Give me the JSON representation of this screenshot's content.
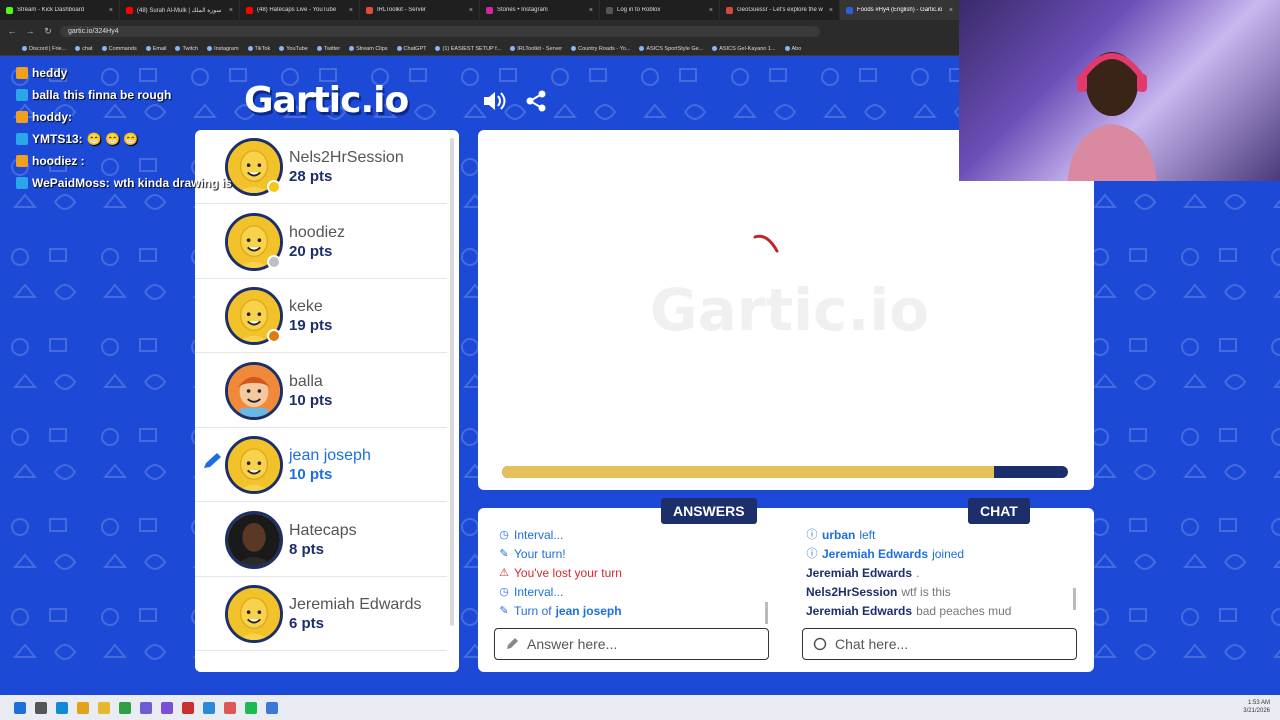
{
  "browser": {
    "tabs": [
      {
        "title": "Stream - Kick Dashboard",
        "color": "#53fc18"
      },
      {
        "title": "(48) Surah Al-Mulk | سورة الملك",
        "color": "#ff0000"
      },
      {
        "title": "(48) Hatecaps Live - YouTube",
        "color": "#ff0000"
      },
      {
        "title": "IRLToolkit - Server",
        "color": "#e24a3b"
      },
      {
        "title": "Stories • Instagram",
        "color": "#d6249f"
      },
      {
        "title": "Log in to Roblox",
        "color": "#555555"
      },
      {
        "title": "GeoGuessr - Let's explore the w",
        "color": "#d14b3d"
      },
      {
        "title": "Foods #Hy4 (English) - Gartic.io",
        "color": "#2a5fd8",
        "active": true
      }
    ],
    "url": "gartic.io/324Hy4",
    "bookmarks": [
      "Discord | Frie...",
      "chat",
      "Commands",
      "Email",
      "Twitch",
      "Instagram",
      "TikTok",
      "YouTube",
      "Twitter",
      "Stream Clips",
      "ChatGPT",
      "(1) EASIEST SETUP f...",
      "IRLToolkit - Server",
      "Country Roads - Yo...",
      "ASICS SportStyle Ge...",
      "ASICS Gel-Kayano 1...",
      "Abo"
    ]
  },
  "stream_chat": [
    {
      "user": "heddy",
      "text": ""
    },
    {
      "user": "balla",
      "text": "this finna be rough"
    },
    {
      "user": "hoddy:",
      "text": ""
    },
    {
      "user": "YMTS13:",
      "text": "😁 😁 😁"
    },
    {
      "user": "hoodiez :",
      "text": ""
    },
    {
      "user": "WePaidMoss:",
      "text": "wth kinda drawing is"
    }
  ],
  "game": {
    "logo": "Gartic.io",
    "watermark": "Gartic.io",
    "timer_remaining": 0.87
  },
  "players": [
    {
      "name": "Nels2HrSession",
      "pts": "28 pts",
      "badge": "#f5c518",
      "avatar": "default"
    },
    {
      "name": "hoodiez",
      "pts": "20 pts",
      "badge": "#bfbfbf",
      "avatar": "default"
    },
    {
      "name": "keke",
      "pts": "19 pts",
      "badge": "#e07a10",
      "avatar": "default"
    },
    {
      "name": "balla",
      "pts": "10 pts",
      "badge": "",
      "avatar": "redhead"
    },
    {
      "name": "jean joseph",
      "pts": "10 pts",
      "badge": "",
      "avatar": "default",
      "drawing": true
    },
    {
      "name": "Hatecaps",
      "pts": "8 pts",
      "badge": "",
      "avatar": "photo"
    },
    {
      "name": "Jeremiah Edwards",
      "pts": "6 pts",
      "badge": "",
      "avatar": "default"
    }
  ],
  "answers": {
    "title": "ANSWERS",
    "placeholder": "Answer here...",
    "messages": [
      {
        "icon": "clock",
        "text": "Interval...",
        "color": "blue"
      },
      {
        "icon": "pencil",
        "text": "Your turn!",
        "color": "blue"
      },
      {
        "icon": "warning",
        "text": "You've lost your turn",
        "color": "red"
      },
      {
        "icon": "clock",
        "text": "Interval...",
        "color": "blue"
      },
      {
        "icon": "pencil",
        "text": "Turn of",
        "bold_part": "jean joseph",
        "color": "blue"
      }
    ]
  },
  "chat": {
    "title": "CHAT",
    "placeholder": "Chat here...",
    "messages": [
      {
        "icon": "info",
        "user": "urban",
        "text": "left"
      },
      {
        "icon": "info",
        "user": "Jeremiah Edwards",
        "text": "joined"
      },
      {
        "icon": "",
        "user": "Jeremiah Edwards",
        "text": "."
      },
      {
        "icon": "",
        "user": "Nels2HrSession",
        "text": "wtf is this"
      },
      {
        "icon": "",
        "user": "Jeremiah Edwards",
        "text": "bad peaches mud"
      }
    ]
  },
  "taskbar": {
    "time": "1:53 AM",
    "date": "3/21/2026"
  }
}
